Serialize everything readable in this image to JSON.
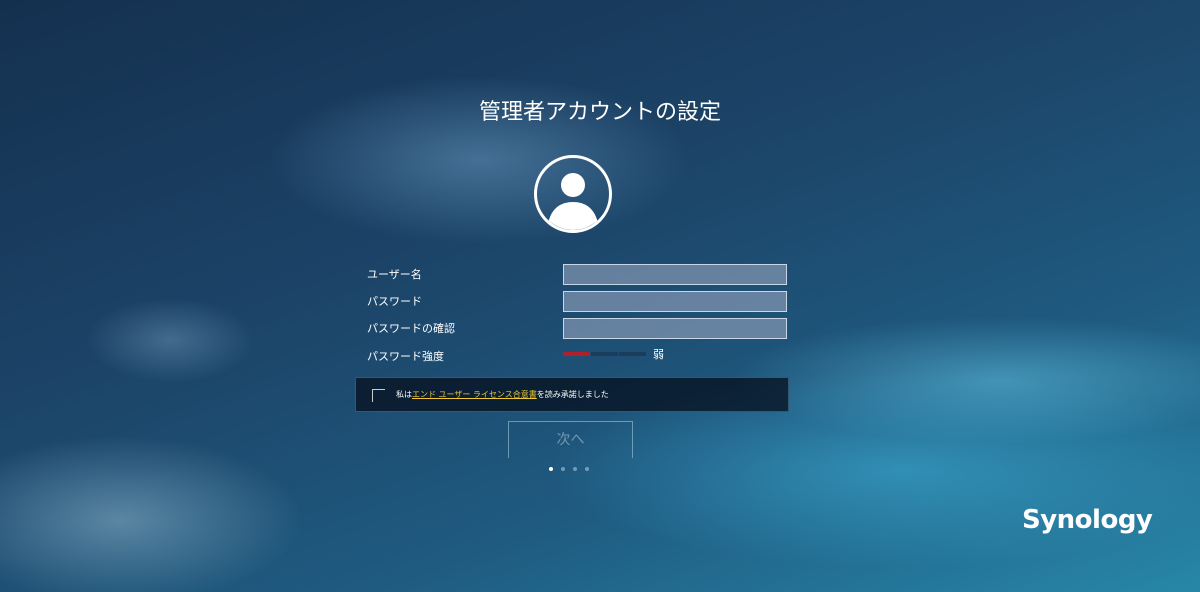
{
  "title": "管理者アカウントの設定",
  "form": {
    "username_label": "ユーザー名",
    "username_value": "",
    "password_label": "パスワード",
    "password_value": "",
    "confirm_label": "パスワードの確認",
    "confirm_value": "",
    "strength_label": "パスワード強度",
    "strength_text": "弱",
    "strength_level": 1,
    "strength_max": 3,
    "strength_color": "#b0202a"
  },
  "eula": {
    "prefix": "私は",
    "link": "エンド ユーザー ライセンス合意書",
    "suffix": "を読み承諾しました",
    "checked": false
  },
  "next_label": "次へ",
  "pager": {
    "current": 1,
    "total": 4
  },
  "brand": "Synology"
}
